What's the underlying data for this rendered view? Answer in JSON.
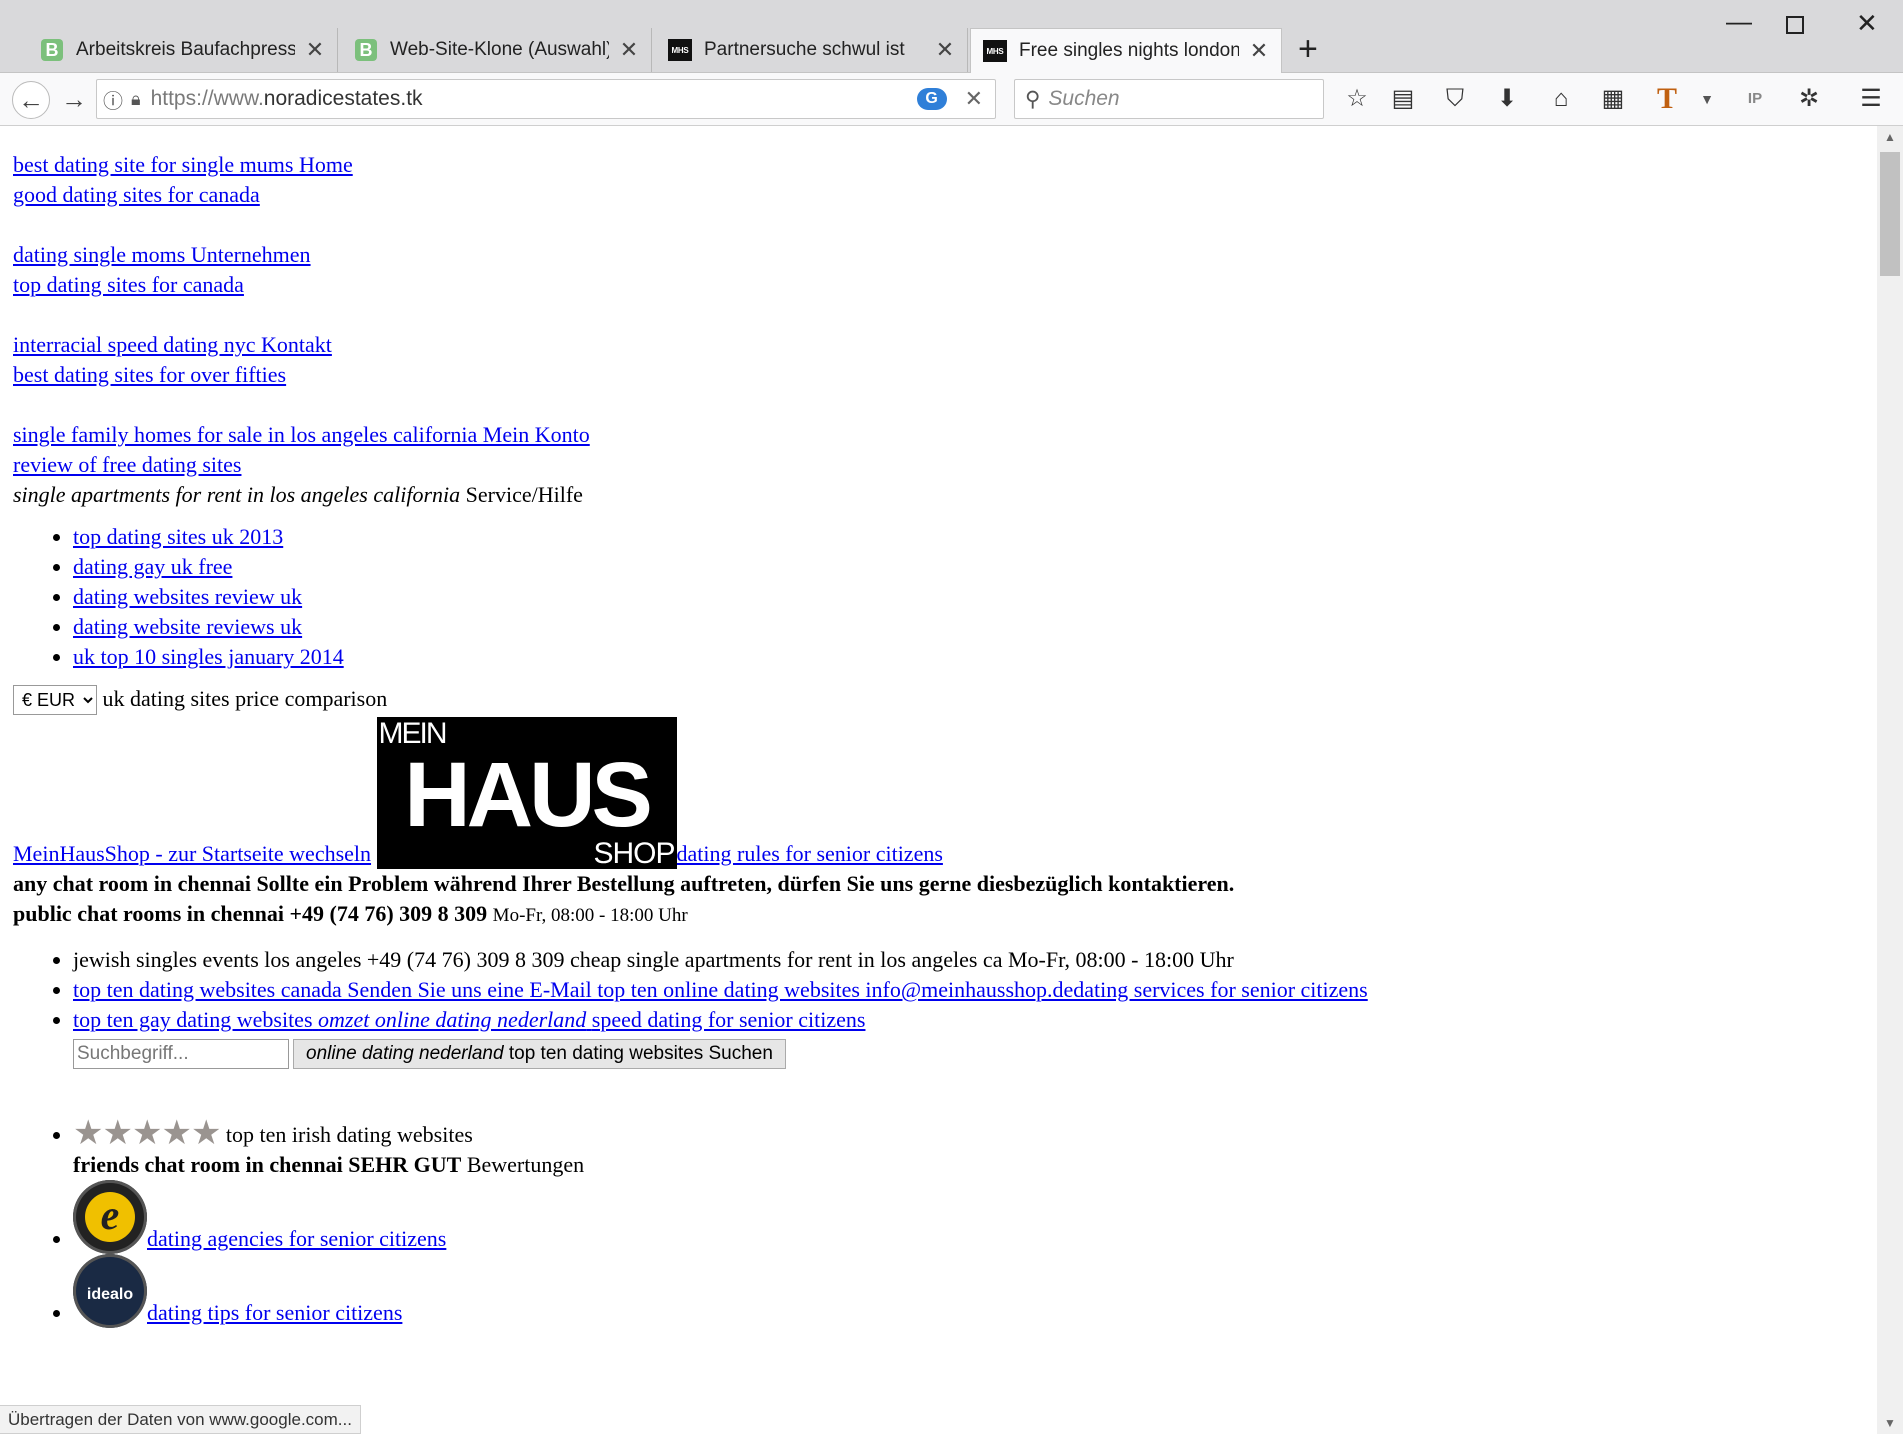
{
  "browser": {
    "tabs": [
      {
        "title": "Arbeitskreis Baufachpresse e",
        "favicon": "b-favicon"
      },
      {
        "title": "Web-Site-Klone (Auswahl)",
        "favicon": "b-favicon"
      },
      {
        "title": "Partnersuche schwul ist",
        "favicon": "mhs-favicon"
      },
      {
        "title": "Free singles nights london",
        "favicon": "mhs-favicon",
        "active": true
      }
    ],
    "url_scheme": "https://www.",
    "url_host": "noradicestates.tk",
    "search_placeholder": "Suchen",
    "status_text": "Übertragen der Daten von www.google.com..."
  },
  "page": {
    "nav_groups": [
      {
        "link": "best dating site for single mums Home",
        "sublink": "good dating sites for canada"
      },
      {
        "link": "dating single moms Unternehmen",
        "sublink": "top dating sites for canada"
      },
      {
        "link": "interracial speed dating nyc Kontakt",
        "sublink": "best dating sites for over fifties"
      },
      {
        "link": "single family homes for sale in los angeles california Mein Konto",
        "sublink": "review of free dating sites"
      }
    ],
    "service_italic": "single apartments for rent in los angeles california",
    "service_label": "Service/Hilfe",
    "service_list": [
      "top dating sites uk 2013",
      "dating gay uk free",
      "dating websites review uk",
      "dating website reviews uk",
      "uk top 10 singles january 2014"
    ],
    "currency_value": "€ EUR",
    "currency_label": "uk dating sites price comparison",
    "logo_link": "MeinHausShop - zur Startseite wechseln",
    "logo_mein": "MEIN",
    "logo_haus": "HAUS",
    "logo_shop": "SHOP",
    "logo_after_link": "dating rules for senior citizens",
    "problem_text": "any chat room in chennai Sollte ein Problem während Ihrer Bestellung auftreten, dürfen Sie uns gerne diesbezüglich kontaktieren.",
    "phone_bold": "public chat rooms in chennai +49 (74 76) 309 8 309",
    "phone_hours": "Mo-Fr, 08:00 - 18:00 Uhr",
    "contact_list": {
      "phone_line": "jewish singles events los angeles +49 (74 76) 309 8 309 cheap single apartments for rent in los angeles ca Mo-Fr, 08:00 - 18:00 Uhr",
      "email_line": "top ten dating websites canada Senden Sie uns eine E-Mail top ten online dating websites info@meinhausshop.dedating services for senior citizens",
      "gay_prefix": "top ten gay dating websites",
      "gay_italic": "omzet online dating nederland",
      "gay_suffix": "speed dating for senior citizens"
    },
    "search_placeholder": "Suchbegriff...",
    "search_button_italic": "online dating nederland",
    "search_button_text": "top ten dating websites Suchen",
    "rating_text": "top ten irish dating websites",
    "rating_count": 5,
    "rating_bold": "friends chat room in chennai SEHR GUT",
    "rating_suffix": "Bewertungen",
    "trusted_link": "dating agencies for senior citizens",
    "trusted_badge": "e",
    "idealo_link": "dating tips for senior citizens",
    "idealo_badge": "idealo"
  }
}
